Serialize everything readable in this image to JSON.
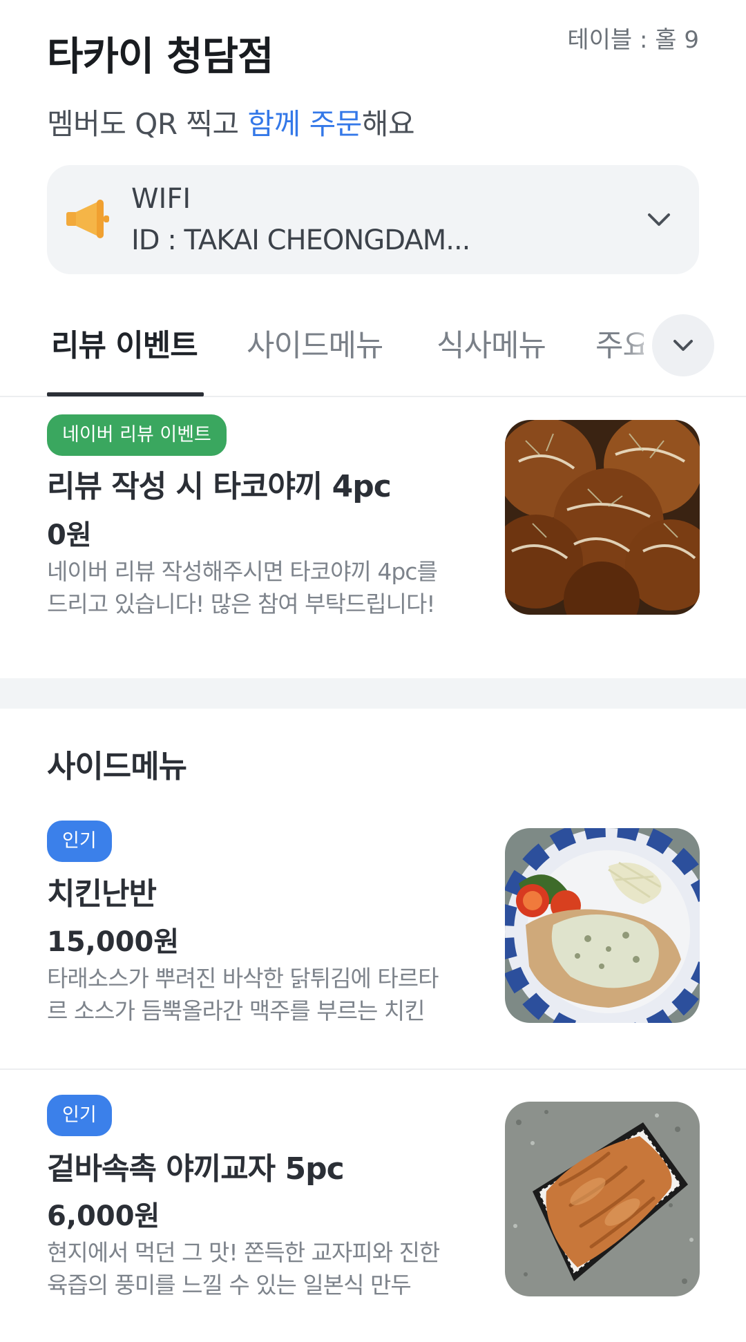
{
  "header": {
    "store_name": "타카이 청담점",
    "table_info": "테이블 : 홀 9",
    "subtitle_prefix": "멤버도 QR 찍고 ",
    "subtitle_accent": "함께 주문",
    "subtitle_suffix": "해요"
  },
  "notice": {
    "icon": "megaphone-icon",
    "title": "WIFI",
    "detail": "ID : TAKAI CHEONGDAM..."
  },
  "tabs": [
    {
      "label": "리뷰 이벤트",
      "active": true
    },
    {
      "label": "사이드메뉴",
      "active": false
    },
    {
      "label": "식사메뉴",
      "active": false
    },
    {
      "label": "주요",
      "active": false
    }
  ],
  "review_event": {
    "badge": "네이버 리뷰 이벤트",
    "name": "리뷰 작성 시 타코야끼 4pc",
    "price": "0원",
    "desc_line1": "네이버 리뷰 작성해주시면 타코야끼 4pc를",
    "desc_line2": "드리고 있습니다! 많은 참여 부탁드립니다!"
  },
  "side_menu": {
    "title": "사이드메뉴",
    "items": [
      {
        "badge": "인기",
        "name": "치킨난반",
        "price": "15,000원",
        "desc_line1": "타래소스가 뿌려진 바삭한 닭튀김에 타르타",
        "desc_line2": "르 소스가 듬뿍올라간 맥주를 부르는 치킨"
      },
      {
        "badge": "인기",
        "name": "겉바속촉 야끼교자 5pc",
        "price": "6,000원",
        "desc_line1": "현지에서 먹던 그 맛! 쫀득한 교자피와 진한",
        "desc_line2": "육즙의 풍미를 느낄 수 있는 일본식 만두"
      }
    ]
  },
  "colors": {
    "accent": "#3478e8",
    "badge_green": "#3aa75f",
    "badge_blue": "#3b80ea"
  }
}
